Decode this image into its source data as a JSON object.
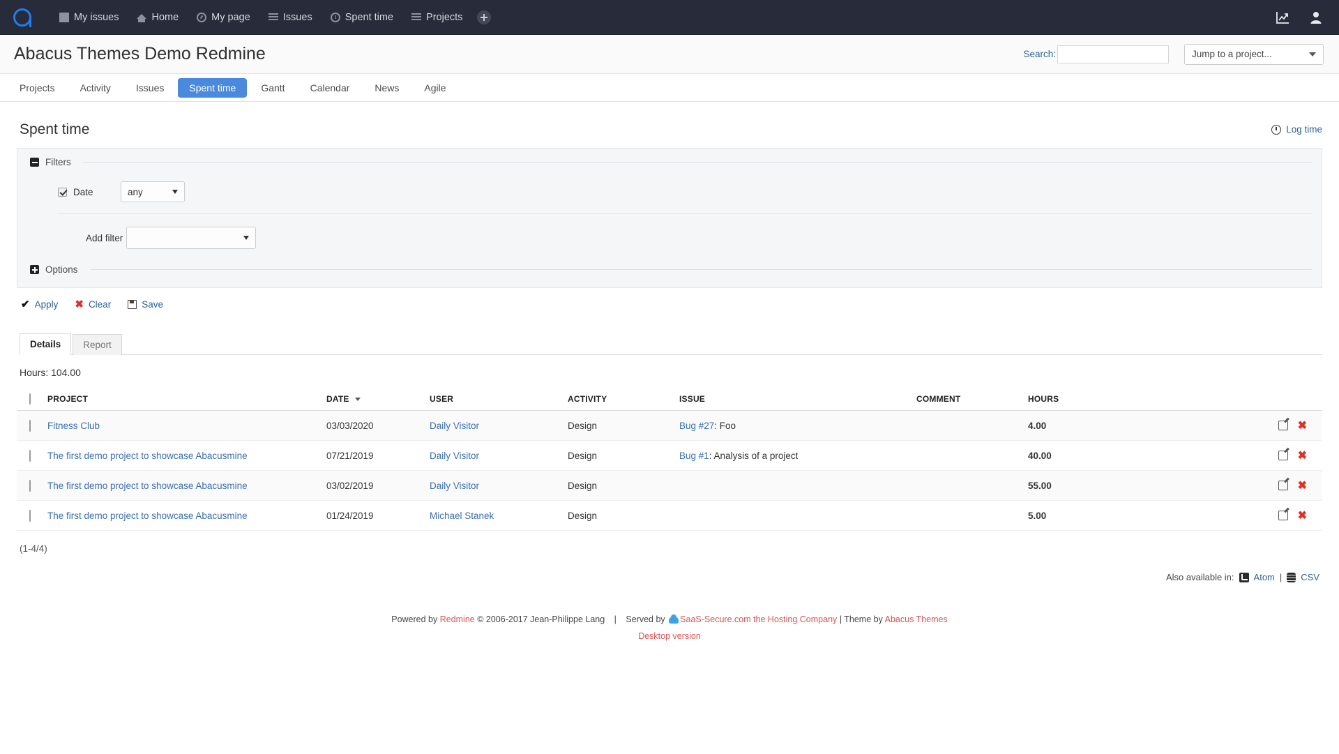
{
  "topbar": {
    "logo_name": "abacus-logo",
    "nav": [
      {
        "label": "My issues",
        "icon": "square-icon"
      },
      {
        "label": "Home",
        "icon": "home-icon"
      },
      {
        "label": "My page",
        "icon": "gauge-icon"
      },
      {
        "label": "Issues",
        "icon": "lines-icon"
      },
      {
        "label": "Spent time",
        "icon": "clock-icon"
      },
      {
        "label": "Projects",
        "icon": "list-icon"
      }
    ],
    "add_button": "plus-icon",
    "right_icons": [
      "chart-icon",
      "user-icon"
    ]
  },
  "header": {
    "title": "Abacus Themes Demo Redmine",
    "search_label": "Search:",
    "search_value": "",
    "search_placeholder": "",
    "jump_to_project": "Jump to a project..."
  },
  "mainmenu": {
    "items": [
      {
        "label": "Projects",
        "active": false
      },
      {
        "label": "Activity",
        "active": false
      },
      {
        "label": "Issues",
        "active": false
      },
      {
        "label": "Spent time",
        "active": true
      },
      {
        "label": "Gantt",
        "active": false
      },
      {
        "label": "Calendar",
        "active": false
      },
      {
        "label": "News",
        "active": false
      },
      {
        "label": "Agile",
        "active": false
      }
    ]
  },
  "page": {
    "title": "Spent time",
    "log_time_label": "Log time"
  },
  "filters": {
    "legend": "Filters",
    "options_legend": "Options",
    "date_filter": {
      "checked": true,
      "label": "Date",
      "operator": "any"
    },
    "add_filter_label": "Add filter",
    "add_filter_value": "",
    "apply_label": "Apply",
    "clear_label": "Clear",
    "save_label": "Save"
  },
  "tabs": [
    {
      "label": "Details",
      "active": true
    },
    {
      "label": "Report",
      "active": false
    }
  ],
  "results": {
    "hours_total": "Hours: 104.00",
    "columns": [
      "PROJECT",
      "DATE",
      "USER",
      "ACTIVITY",
      "ISSUE",
      "COMMENT",
      "HOURS"
    ],
    "sort_column": "DATE",
    "sort_direction": "desc",
    "rows": [
      {
        "project": "Fitness Club",
        "date": "03/03/2020",
        "user": "Daily Visitor",
        "activity": "Design",
        "issue_link": "Bug #27",
        "issue_text": ": Foo",
        "comment": "",
        "hours": "4.00"
      },
      {
        "project": "The first demo project to showcase Abacusmine",
        "date": "07/21/2019",
        "user": "Daily Visitor",
        "activity": "Design",
        "issue_link": "Bug #1",
        "issue_text": ": Analysis of a project",
        "comment": "",
        "hours": "40.00"
      },
      {
        "project": "The first demo project to showcase Abacusmine",
        "date": "03/02/2019",
        "user": "Daily Visitor",
        "activity": "Design",
        "issue_link": "",
        "issue_text": "",
        "comment": "",
        "hours": "55.00"
      },
      {
        "project": "The first demo project to showcase Abacusmine",
        "date": "01/24/2019",
        "user": "Michael Stanek",
        "activity": "Design",
        "issue_link": "",
        "issue_text": "",
        "comment": "",
        "hours": "5.00"
      }
    ],
    "pager": "(1-4/4)"
  },
  "otherformats": {
    "label": "Also available in:",
    "atom": "Atom",
    "separator": "|",
    "csv": "CSV"
  },
  "footer": {
    "powered_prefix": "Powered by ",
    "redmine": "Redmine",
    "copyright": " © 2006-2017 Jean-Philippe Lang",
    "sep1": "|",
    "served_prefix": "Served by ",
    "host": "SaaS-Secure.com the Hosting Company",
    "theme_prefix": " | Theme by ",
    "theme": "Abacus Themes",
    "desktop_version": "Desktop version"
  },
  "colors": {
    "topbar_bg": "#282c3a",
    "accent_blue": "#4a89dc",
    "logo_blue": "#1e7ef0",
    "link_blue": "#3a6fb0",
    "footer_link": "#d9534f",
    "danger_red": "#e03024"
  }
}
